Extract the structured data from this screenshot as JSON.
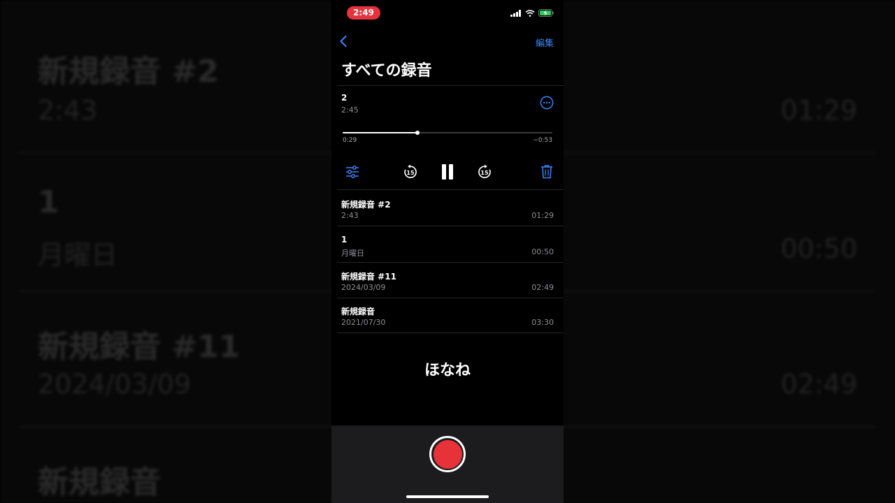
{
  "background": {
    "rows": [
      {
        "title": "新規録音 #2",
        "subtitle": "2:43",
        "duration": "01:29"
      },
      {
        "title": "1",
        "subtitle": "月曜日",
        "duration": "00:50"
      },
      {
        "title": "新規録音 #11",
        "subtitle": "2024/03/09",
        "duration": "02:49"
      },
      {
        "title": "新規録音",
        "subtitle": "",
        "duration": ""
      }
    ]
  },
  "status_bar": {
    "time": "2:49",
    "icons": [
      "signal-icon",
      "wifi-icon",
      "battery-charging-icon"
    ]
  },
  "nav": {
    "back_icon": "chevron-left-icon",
    "edit_label": "編集",
    "title": "すべての録音"
  },
  "current": {
    "name": "2",
    "date": "2:45",
    "elapsed": "0:29",
    "remaining": "−0:53",
    "progress": 0.355
  },
  "controls": {
    "skip_back_label": "15",
    "skip_forward_label": "15",
    "icons": [
      "settings-sliders-icon",
      "skip-back-15-icon",
      "pause-icon",
      "skip-forward-15-icon",
      "trash-icon"
    ]
  },
  "recordings": [
    {
      "name": "新規録音 #2",
      "date": "2:43",
      "duration": "01:29"
    },
    {
      "name": "1",
      "date": "月曜日",
      "duration": "00:50"
    },
    {
      "name": "新規録音 #11",
      "date": "2024/03/09",
      "duration": "02:49"
    },
    {
      "name": "新規録音",
      "date": "2021/07/30",
      "duration": "03:30"
    }
  ],
  "caption": "ほなね",
  "colors": {
    "accent": "#3a82f7",
    "record": "#e8323a",
    "time_pill": "#e5343c",
    "secondary_text": "#8e8e93"
  }
}
